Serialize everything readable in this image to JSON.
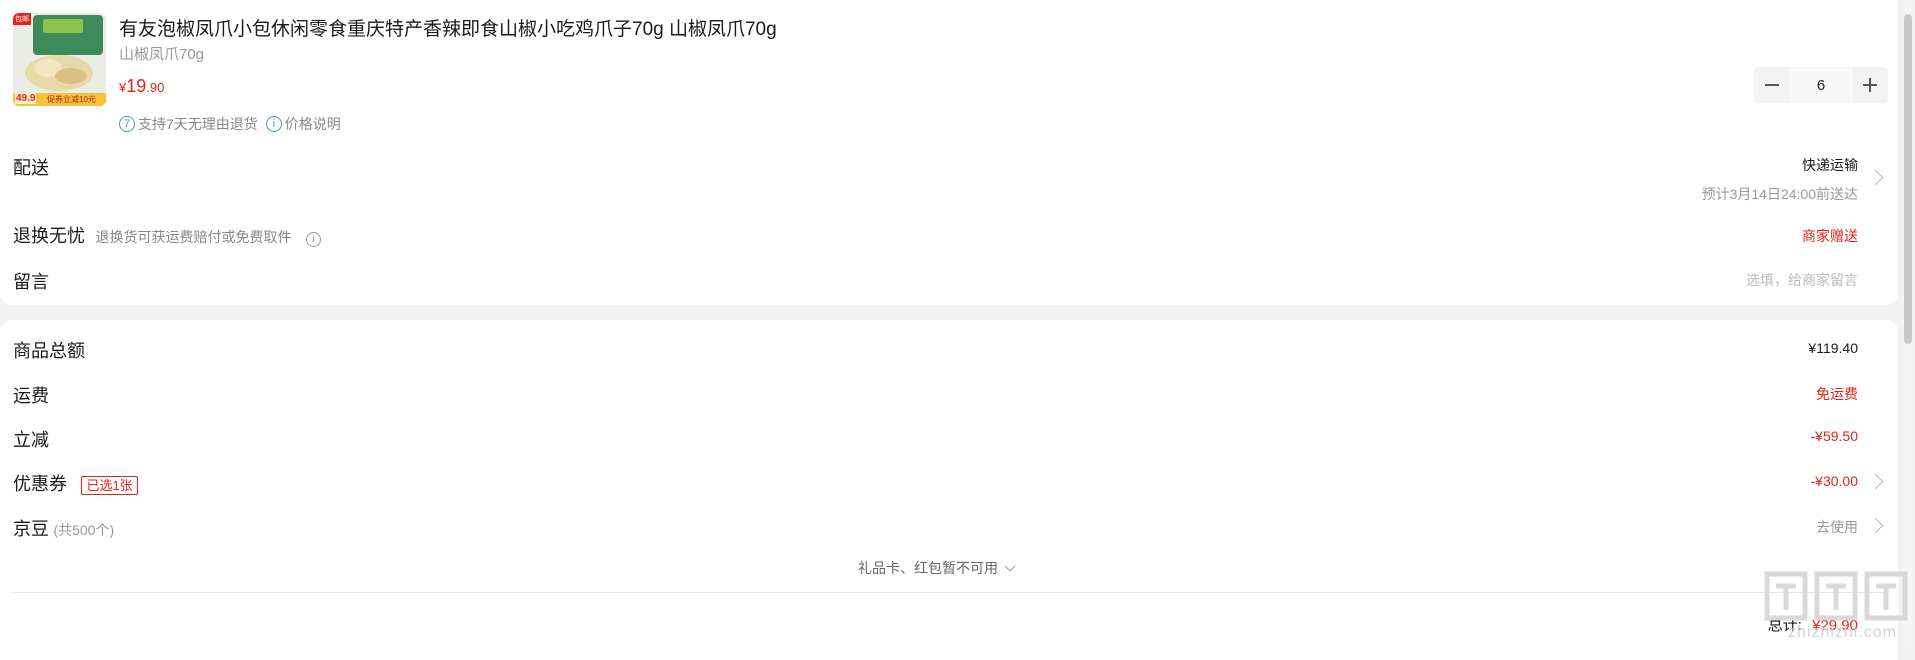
{
  "product": {
    "title": "有友泡椒凤爪小包休闲零食重庆特产香辣即食山椒小吃鸡爪子70g 山椒凤爪70g",
    "spec": "山椒凤爪70g",
    "price_symbol": "¥",
    "price_int": "19",
    "price_dec": ".90",
    "tag1_icon": "7",
    "tag1": "支持7天无理由退货",
    "tag2_icon": "i",
    "tag2": "价格说明",
    "quantity": "6",
    "thumb_badge": "包邮",
    "thumb_price": "49.9",
    "thumb_promo": "促券立减10元"
  },
  "delivery": {
    "label": "配送",
    "method": "快递运输",
    "eta": "预计3月14日24:00前送达"
  },
  "returns": {
    "label": "退换无忧",
    "desc": "退换货可获运费赔付或免费取件",
    "value": "商家赠送"
  },
  "note": {
    "label": "留言",
    "placeholder": "选填，给商家留言"
  },
  "summary": {
    "total_label": "商品总额",
    "total_value": "¥119.40",
    "shipping_label": "运费",
    "shipping_value": "免运费",
    "discount_label": "立减",
    "discount_value": "-¥59.50",
    "coupon_label": "优惠券",
    "coupon_badge": "已选1张",
    "coupon_value": "-¥30.00",
    "beans_label": "京豆",
    "beans_count": "(共500个)",
    "beans_value": "去使用",
    "giftcard_note": "礼品卡、红包暂不可用",
    "grand_label": "总计:",
    "grand_value": "¥29.90"
  },
  "watermark": {
    "text": "zhizhizhi.com"
  },
  "colors": {
    "accent_red": "#e2231a",
    "info_blue": "#4a90e2",
    "background": "#f2f2f2"
  }
}
